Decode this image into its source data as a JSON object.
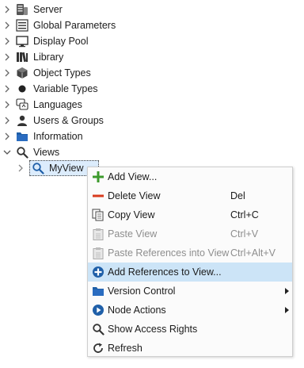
{
  "tree": {
    "items": [
      {
        "label": "Server",
        "icon": "server-icon"
      },
      {
        "label": "Global Parameters",
        "icon": "global-parameters-icon"
      },
      {
        "label": "Display Pool",
        "icon": "display-pool-icon"
      },
      {
        "label": "Library",
        "icon": "library-icon"
      },
      {
        "label": "Object Types",
        "icon": "object-types-icon"
      },
      {
        "label": "Variable Types",
        "icon": "variable-types-icon"
      },
      {
        "label": "Languages",
        "icon": "languages-icon"
      },
      {
        "label": "Users & Groups",
        "icon": "users-groups-icon"
      },
      {
        "label": "Information",
        "icon": "folder-icon"
      },
      {
        "label": "Views",
        "icon": "magnifier-icon",
        "expanded": true
      }
    ],
    "child": {
      "label": "MyView",
      "icon": "magnifier-icon",
      "selected": true
    }
  },
  "context_menu": {
    "items": [
      {
        "label": "Add View...",
        "shortcut": "",
        "icon": "plus-icon",
        "enabled": true
      },
      {
        "label": "Delete View",
        "shortcut": "Del",
        "icon": "minus-icon",
        "enabled": true
      },
      {
        "label": "Copy View",
        "shortcut": "Ctrl+C",
        "icon": "copy-icon",
        "enabled": true
      },
      {
        "label": "Paste View",
        "shortcut": "Ctrl+V",
        "icon": "paste-icon",
        "enabled": false
      },
      {
        "label": "Paste References into View",
        "shortcut": "Ctrl+Alt+V",
        "icon": "paste-icon",
        "enabled": false
      },
      {
        "label": "Add References to View...",
        "shortcut": "",
        "icon": "add-circle-icon",
        "enabled": true,
        "highlighted": true
      },
      {
        "label": "Version Control",
        "shortcut": "",
        "icon": "folder-icon",
        "enabled": true,
        "submenu": true
      },
      {
        "label": "Node Actions",
        "shortcut": "",
        "icon": "play-circle-icon",
        "enabled": true,
        "submenu": true
      },
      {
        "label": "Show Access Rights",
        "shortcut": "",
        "icon": "magnifier-icon",
        "enabled": true
      },
      {
        "label": "Refresh",
        "shortcut": "",
        "icon": "refresh-icon",
        "enabled": true
      }
    ]
  },
  "colors": {
    "highlight": "#cce4f7",
    "selection": "#dcecfc",
    "accent_blue": "#1f5fa8",
    "plus_green": "#3c9a2c",
    "minus_red": "#d83b1e"
  }
}
